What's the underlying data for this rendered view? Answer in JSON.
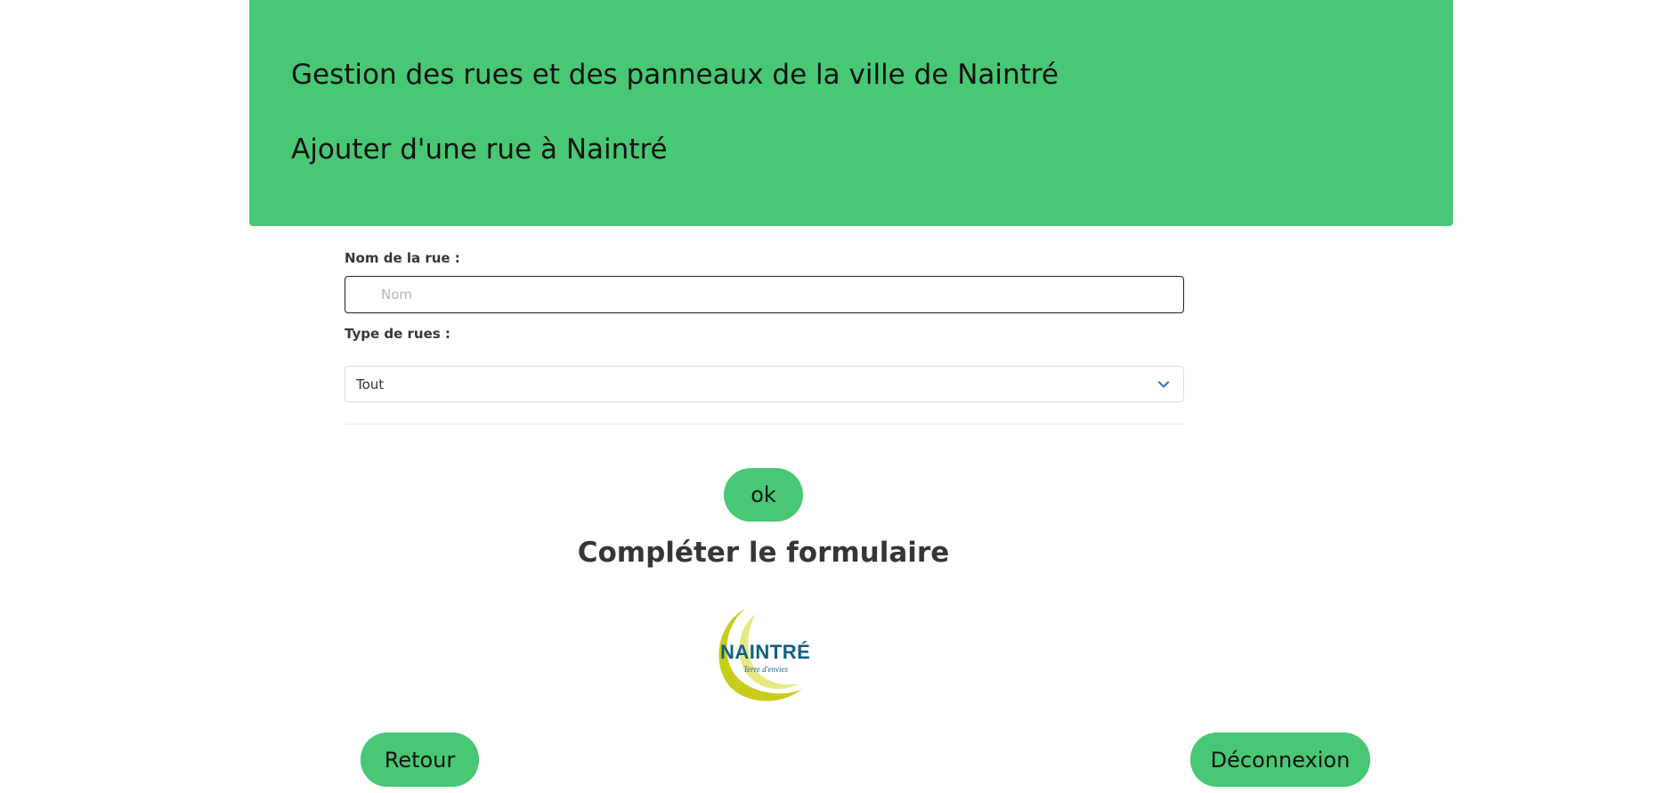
{
  "header": {
    "title": "Gestion des rues et des panneaux de la ville de Naintré",
    "subtitle": "Ajouter d'une rue à Naintré"
  },
  "form": {
    "street_name_label": "Nom de la rue :",
    "street_name_placeholder": "Nom",
    "street_name_value": "",
    "street_type_label": "Type de rues :",
    "street_type_selected": "Tout",
    "submit_label": "ok"
  },
  "message": "Compléter le formulaire",
  "logo": {
    "text": "NAINTRÉ",
    "tagline": "Terre d'envies"
  },
  "footer": {
    "back_label": "Retour",
    "logout_label": "Déconnexion"
  },
  "colors": {
    "accent": "#48c774",
    "logo_blue": "#0f5f85",
    "logo_yellow": "#c8cc1a"
  },
  "icons": {
    "select": "chevron-down-icon"
  }
}
